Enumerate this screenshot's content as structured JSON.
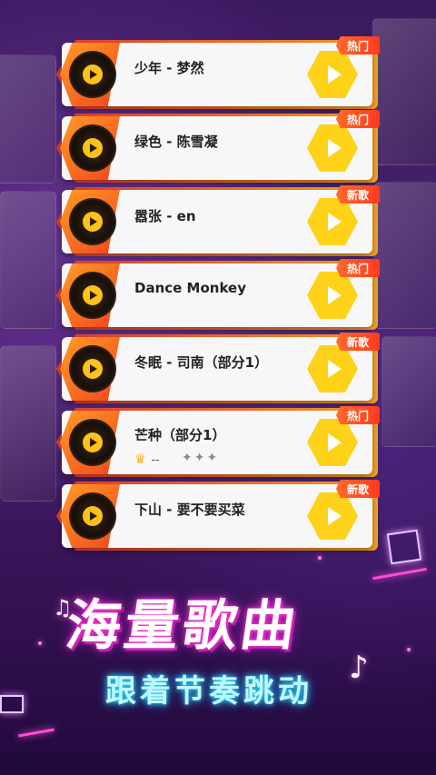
{
  "songs": [
    {
      "title": "少年 - 梦然",
      "badge": "热门"
    },
    {
      "title": "绿色 - 陈雪凝",
      "badge": "热门"
    },
    {
      "title": "嚣张 - en",
      "badge": "新歌"
    },
    {
      "title": "Dance Monkey",
      "badge": "热门"
    },
    {
      "title": "冬眠 -  司南（部分1）",
      "badge": "新歌"
    },
    {
      "title": "芒种（部分1）",
      "badge": "热门",
      "score": "--",
      "stars": "✦✦✦"
    },
    {
      "title": "下山 -  要不要买菜",
      "badge": "新歌"
    }
  ],
  "promo": {
    "headline": "海量歌曲",
    "subline": "跟着节奏跳动"
  },
  "colors": {
    "badge": "#ff4a24",
    "play_button": "#ffd21a",
    "row_accent": "#f36d25"
  }
}
